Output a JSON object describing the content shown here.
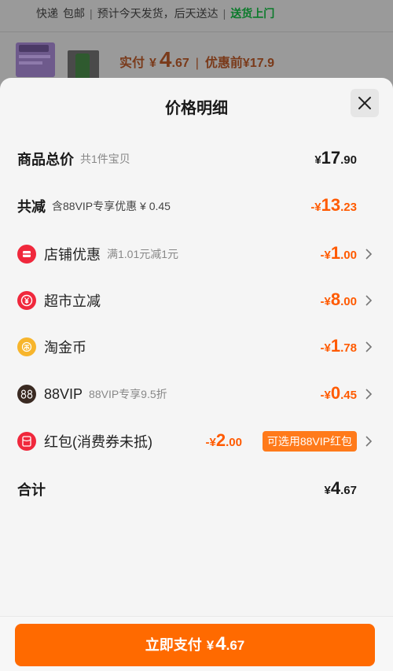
{
  "background": {
    "shipping": {
      "method": "快递",
      "fee": "包邮",
      "estimate": "预计今天发货，后天送达",
      "highlight": "送货上门"
    },
    "price_bar": {
      "label": "实付",
      "currency": "¥",
      "amount_int": "4",
      "amount_dec": ".67",
      "before_label": "优惠前",
      "before_amount": "¥17.9"
    }
  },
  "sheet": {
    "title": "价格明细",
    "close_icon": "close-icon",
    "rows": {
      "total": {
        "title": "商品总价",
        "sub": "共1件宝贝",
        "currency": "¥",
        "int": "17",
        "dec": ".90"
      },
      "reduce": {
        "title": "共减",
        "sub": "含88VIP专享优惠 ¥ 0.45",
        "currency": "-¥",
        "int": "13",
        "dec": ".23"
      },
      "shop": {
        "title": "店铺优惠",
        "sub": "满1.01元减1元",
        "currency": "-¥",
        "int": "1",
        "dec": ".00",
        "icon": "shop-coupon-icon",
        "icon_color": "#f0283c"
      },
      "market": {
        "title": "超市立减",
        "currency": "-¥",
        "int": "8",
        "dec": ".00",
        "icon": "yen-discount-icon",
        "icon_color": "#f0283c"
      },
      "coin": {
        "title": "淘金币",
        "currency": "-¥",
        "int": "1",
        "dec": ".78",
        "icon": "gold-coin-icon",
        "icon_color": "#f7b52c"
      },
      "vip": {
        "title": "88VIP",
        "sub": "88VIP专享9.5折",
        "currency": "-¥",
        "int": "0",
        "dec": ".45",
        "icon": "vip-88-icon",
        "icon_color": "#3a2a22"
      },
      "redpacket": {
        "title": "红包(消费券未抵)",
        "currency": "-¥",
        "int": "2",
        "dec": ".00",
        "badge": "可选用88VIP红包",
        "icon": "red-packet-icon",
        "icon_color": "#f0283c"
      },
      "sum": {
        "title": "合计",
        "currency": "¥",
        "int": "4",
        "dec": ".67"
      }
    }
  },
  "pay_button": {
    "label": "立即支付",
    "currency": "¥",
    "int": "4",
    "dec": ".67"
  },
  "colors": {
    "accent": "#ff6a00",
    "discount": "#ff5a00",
    "ship_green": "#0a7a2a"
  }
}
